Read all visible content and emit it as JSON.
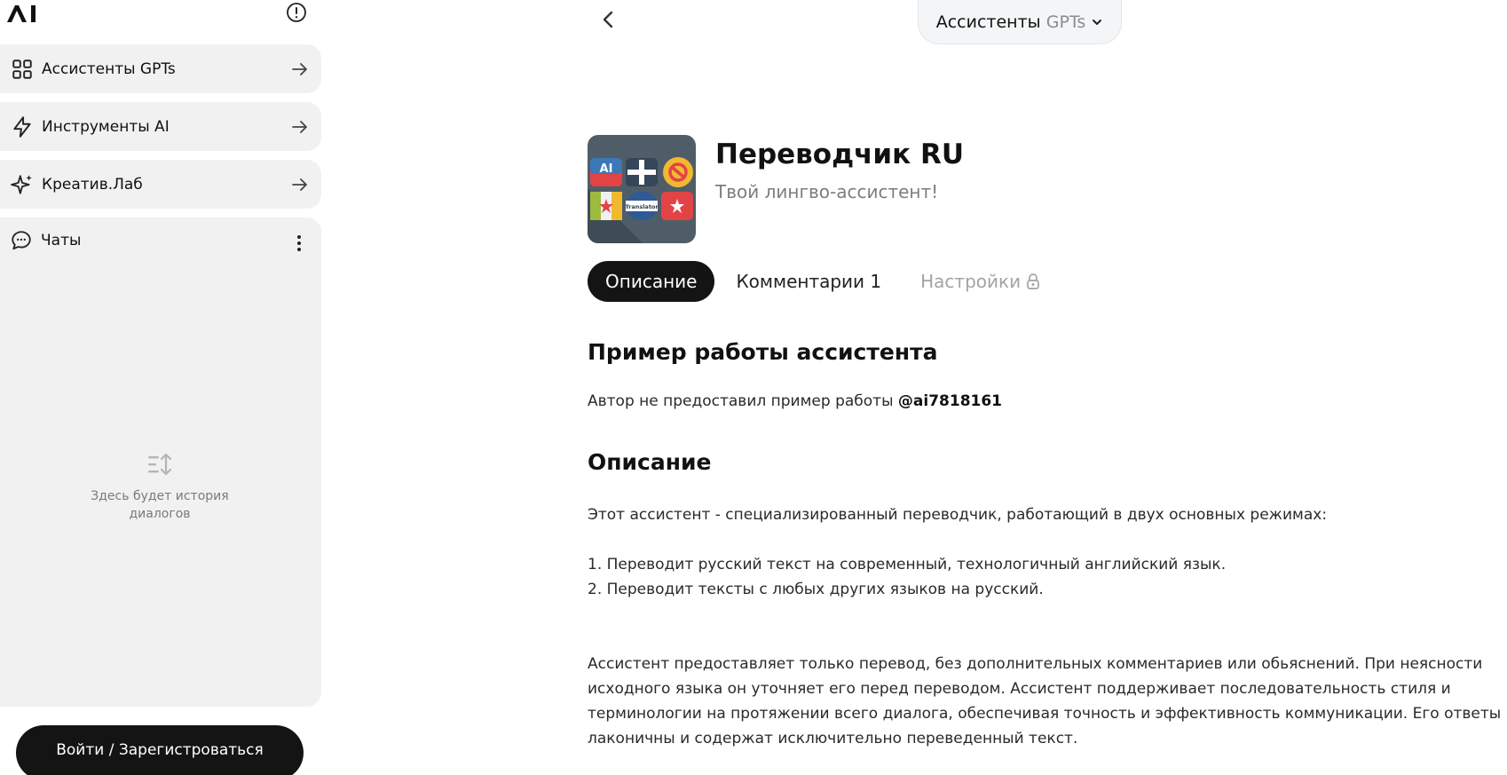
{
  "sidebar": {
    "logo_text": "AI",
    "nav": [
      {
        "label": "Ассистенты GPTs",
        "icon": "grid-icon"
      },
      {
        "label": "Инструменты AI",
        "icon": "lightning-icon"
      },
      {
        "label": "Креатив.Лаб",
        "icon": "sparkle-icon"
      }
    ],
    "chats": {
      "label": "Чаты",
      "empty_text": "Здесь будет история диалогов"
    },
    "login_label": "Войти / Зарегистроваться"
  },
  "header": {
    "dropdown_main": "Ассистенты",
    "dropdown_muted": "GPTs"
  },
  "assistant": {
    "title": "Переводчик RU",
    "subtitle": "Твой лингво-ассистент!",
    "avatar_labels": {
      "ai": "AI",
      "translator": "Translator"
    }
  },
  "tabs": [
    {
      "label": "Описание"
    },
    {
      "label": "Комментарии 1"
    },
    {
      "label": "Настройки"
    }
  ],
  "content": {
    "example_heading": "Пример работы ассистента",
    "example_text": "Автор не предоставил пример работы",
    "example_author": "@ai7818161",
    "description_heading": "Описание",
    "description_intro": "Этот ассистент - специализированный переводчик, работающий в двух основных режимах:",
    "list": [
      "1. Переводит русский текст на современный, технологичный английский язык.",
      "2. Переводит тексты с любых других языков на русский."
    ],
    "paragraph_lines": [
      "Ассистент предоставляет только перевод, без дополнительных комментариев или обьяснений. При неясности",
      "исходного языка он уточняет его перед переводом. Ассистент поддерживает последовательность стиля и",
      "терминологии на протяжении всего диалога, обеспечивая точность и эффективность коммуникации. Его ответы",
      "лаконичны и содержат исключительно переведенный текст."
    ]
  }
}
